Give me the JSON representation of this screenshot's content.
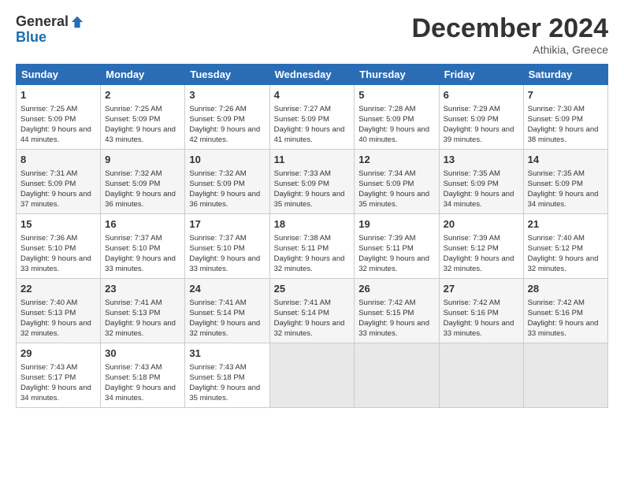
{
  "logo": {
    "line1": "General",
    "line2": "Blue"
  },
  "title": "December 2024",
  "subtitle": "Athikia, Greece",
  "headers": [
    "Sunday",
    "Monday",
    "Tuesday",
    "Wednesday",
    "Thursday",
    "Friday",
    "Saturday"
  ],
  "weeks": [
    [
      {
        "day": "1",
        "sunrise": "7:25 AM",
        "sunset": "5:09 PM",
        "daylight": "9 hours and 44 minutes."
      },
      {
        "day": "2",
        "sunrise": "7:25 AM",
        "sunset": "5:09 PM",
        "daylight": "9 hours and 43 minutes."
      },
      {
        "day": "3",
        "sunrise": "7:26 AM",
        "sunset": "5:09 PM",
        "daylight": "9 hours and 42 minutes."
      },
      {
        "day": "4",
        "sunrise": "7:27 AM",
        "sunset": "5:09 PM",
        "daylight": "9 hours and 41 minutes."
      },
      {
        "day": "5",
        "sunrise": "7:28 AM",
        "sunset": "5:09 PM",
        "daylight": "9 hours and 40 minutes."
      },
      {
        "day": "6",
        "sunrise": "7:29 AM",
        "sunset": "5:09 PM",
        "daylight": "9 hours and 39 minutes."
      },
      {
        "day": "7",
        "sunrise": "7:30 AM",
        "sunset": "5:09 PM",
        "daylight": "9 hours and 38 minutes."
      }
    ],
    [
      {
        "day": "8",
        "sunrise": "7:31 AM",
        "sunset": "5:09 PM",
        "daylight": "9 hours and 37 minutes."
      },
      {
        "day": "9",
        "sunrise": "7:32 AM",
        "sunset": "5:09 PM",
        "daylight": "9 hours and 36 minutes."
      },
      {
        "day": "10",
        "sunrise": "7:32 AM",
        "sunset": "5:09 PM",
        "daylight": "9 hours and 36 minutes."
      },
      {
        "day": "11",
        "sunrise": "7:33 AM",
        "sunset": "5:09 PM",
        "daylight": "9 hours and 35 minutes."
      },
      {
        "day": "12",
        "sunrise": "7:34 AM",
        "sunset": "5:09 PM",
        "daylight": "9 hours and 35 minutes."
      },
      {
        "day": "13",
        "sunrise": "7:35 AM",
        "sunset": "5:09 PM",
        "daylight": "9 hours and 34 minutes."
      },
      {
        "day": "14",
        "sunrise": "7:35 AM",
        "sunset": "5:09 PM",
        "daylight": "9 hours and 34 minutes."
      }
    ],
    [
      {
        "day": "15",
        "sunrise": "7:36 AM",
        "sunset": "5:10 PM",
        "daylight": "9 hours and 33 minutes."
      },
      {
        "day": "16",
        "sunrise": "7:37 AM",
        "sunset": "5:10 PM",
        "daylight": "9 hours and 33 minutes."
      },
      {
        "day": "17",
        "sunrise": "7:37 AM",
        "sunset": "5:10 PM",
        "daylight": "9 hours and 33 minutes."
      },
      {
        "day": "18",
        "sunrise": "7:38 AM",
        "sunset": "5:11 PM",
        "daylight": "9 hours and 32 minutes."
      },
      {
        "day": "19",
        "sunrise": "7:39 AM",
        "sunset": "5:11 PM",
        "daylight": "9 hours and 32 minutes."
      },
      {
        "day": "20",
        "sunrise": "7:39 AM",
        "sunset": "5:12 PM",
        "daylight": "9 hours and 32 minutes."
      },
      {
        "day": "21",
        "sunrise": "7:40 AM",
        "sunset": "5:12 PM",
        "daylight": "9 hours and 32 minutes."
      }
    ],
    [
      {
        "day": "22",
        "sunrise": "7:40 AM",
        "sunset": "5:13 PM",
        "daylight": "9 hours and 32 minutes."
      },
      {
        "day": "23",
        "sunrise": "7:41 AM",
        "sunset": "5:13 PM",
        "daylight": "9 hours and 32 minutes."
      },
      {
        "day": "24",
        "sunrise": "7:41 AM",
        "sunset": "5:14 PM",
        "daylight": "9 hours and 32 minutes."
      },
      {
        "day": "25",
        "sunrise": "7:41 AM",
        "sunset": "5:14 PM",
        "daylight": "9 hours and 32 minutes."
      },
      {
        "day": "26",
        "sunrise": "7:42 AM",
        "sunset": "5:15 PM",
        "daylight": "9 hours and 33 minutes."
      },
      {
        "day": "27",
        "sunrise": "7:42 AM",
        "sunset": "5:16 PM",
        "daylight": "9 hours and 33 minutes."
      },
      {
        "day": "28",
        "sunrise": "7:42 AM",
        "sunset": "5:16 PM",
        "daylight": "9 hours and 33 minutes."
      }
    ],
    [
      {
        "day": "29",
        "sunrise": "7:43 AM",
        "sunset": "5:17 PM",
        "daylight": "9 hours and 34 minutes."
      },
      {
        "day": "30",
        "sunrise": "7:43 AM",
        "sunset": "5:18 PM",
        "daylight": "9 hours and 34 minutes."
      },
      {
        "day": "31",
        "sunrise": "7:43 AM",
        "sunset": "5:18 PM",
        "daylight": "9 hours and 35 minutes."
      },
      null,
      null,
      null,
      null
    ]
  ],
  "labels": {
    "sunrise": "Sunrise:",
    "sunset": "Sunset:",
    "daylight": "Daylight:"
  }
}
